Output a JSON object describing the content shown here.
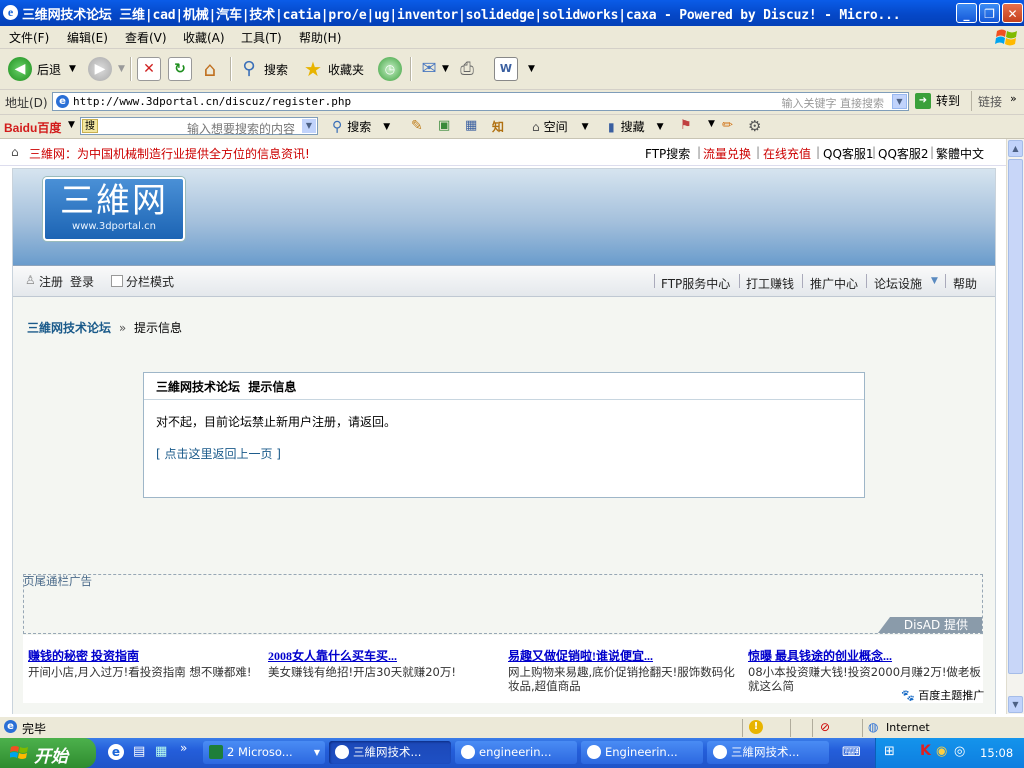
{
  "window": {
    "title": "三维网技术论坛 三维|cad|机械|汽车|技术|catia|pro/e|ug|inventor|solidedge|solidworks|caxa - Powered by Discuz! - Micro...",
    "app_icon": "ie-icon",
    "controls": {
      "minimize": "_",
      "maximize": "❐",
      "close": "✕"
    }
  },
  "menu": [
    "文件(F)",
    "编辑(E)",
    "查看(V)",
    "收藏(A)",
    "工具(T)",
    "帮助(H)"
  ],
  "toolbar": {
    "back": "后退",
    "search": "搜索",
    "favorites": "收藏夹"
  },
  "address": {
    "label": "地址(D)",
    "url": "http://www.3dportal.cn/discuz/register.php",
    "hint": "输入关键字 直接搜索",
    "go": "转到",
    "links": "链接"
  },
  "baidu_bar": {
    "logo": "Baidu百度",
    "input_tag": "搜",
    "placeholder": "输入想要搜索的内容",
    "search": "搜索",
    "space": "空间",
    "collect": "搜藏"
  },
  "site": {
    "slogan": "三維网：为中国机械制造行业提供全方位的信息资讯!",
    "top_links": {
      "ftp_search": "FTP搜索",
      "traffic": "流量兑换",
      "recharge": "在线充值",
      "qq1": "QQ客服1",
      "qq2": "QQ客服2",
      "traditional": "繁體中文"
    },
    "logo_big": "三維网",
    "logo_small": "www.3dportal.cn",
    "nav_left": {
      "register": "注册",
      "login": "登录",
      "split_mode": "分栏模式"
    },
    "nav_right": [
      "FTP服务中心",
      "打工赚钱",
      "推广中心",
      "论坛设施",
      "帮助"
    ],
    "breadcrumb": {
      "forum": "三維网技术论坛",
      "sep": "»",
      "current": "提示信息"
    },
    "message": {
      "header": "三維网技术论坛  提示信息",
      "body": "对不起，目前论坛禁止新用户注册，请返回。",
      "back_link": "[ 点击这里返回上一页 ]"
    },
    "ad": {
      "label": "页尾通栏广告",
      "provider": "DisAD 提供",
      "items": [
        {
          "title": "赚钱的秘密 投资指南",
          "desc": "开间小店,月入过万!看投资指南 想不赚都难!"
        },
        {
          "title": "2008女人靠什么买车买...",
          "desc": "美女赚钱有绝招!开店30天就赚20万!"
        },
        {
          "title": "易趣又做促销啦!谁说便宜...",
          "desc": "网上购物来易趣,底价促销抢翻天!服饰数码化妆品,超值商品"
        },
        {
          "title": "惊曝 最具钱途的创业概念...",
          "desc": "08小本投资赚大钱!投资2000月赚2万!做老板就这么简"
        }
      ],
      "baidu_promo": "百度主题推广"
    }
  },
  "status": {
    "text": "完毕",
    "zone": "Internet"
  },
  "taskbar": {
    "start": "开始",
    "tasks": [
      {
        "label": "2 Microso...",
        "active": false
      },
      {
        "label": "三維网技术...",
        "active": true
      },
      {
        "label": "engineerin...",
        "active": false
      },
      {
        "label": "Engineerin...",
        "active": false
      },
      {
        "label": "三維网技术...",
        "active": false
      }
    ],
    "clock": "15:08"
  }
}
